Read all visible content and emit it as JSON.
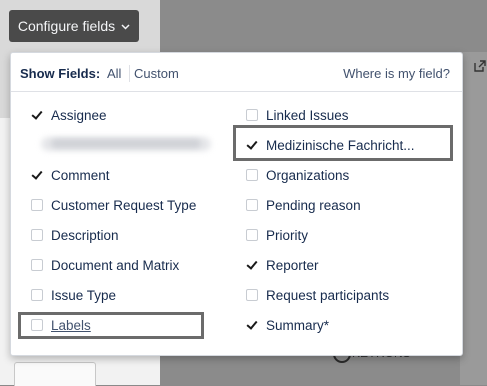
{
  "configure_button": {
    "label": "Configure fields",
    "icon": "chevron-down-icon"
  },
  "popup": {
    "show_fields_label": "Show Fields:",
    "all_label": "All",
    "custom_label": "Custom",
    "where_link": "Where is my field?"
  },
  "fields_left": [
    {
      "label": "Assignee",
      "checked": true
    },
    {
      "label": "",
      "checked": false,
      "blurred": true
    },
    {
      "label": "Comment",
      "checked": true
    },
    {
      "label": "Customer Request Type",
      "checked": false
    },
    {
      "label": "Description",
      "checked": false
    },
    {
      "label": "Document and Matrix",
      "checked": false
    },
    {
      "label": "Issue Type",
      "checked": false
    },
    {
      "label": "Labels",
      "checked": false
    }
  ],
  "fields_right": [
    {
      "label": "Linked Issues",
      "checked": false
    },
    {
      "label": "Medizinische Fachricht...",
      "checked": true
    },
    {
      "label": "Organizations",
      "checked": false
    },
    {
      "label": "Pending reason",
      "checked": false
    },
    {
      "label": "Priority",
      "checked": false
    },
    {
      "label": "Reporter",
      "checked": true
    },
    {
      "label": "Request participants",
      "checked": false
    },
    {
      "label": "Summary*",
      "checked": true
    }
  ],
  "background": {
    "ghost_text": "KEYRONS"
  }
}
